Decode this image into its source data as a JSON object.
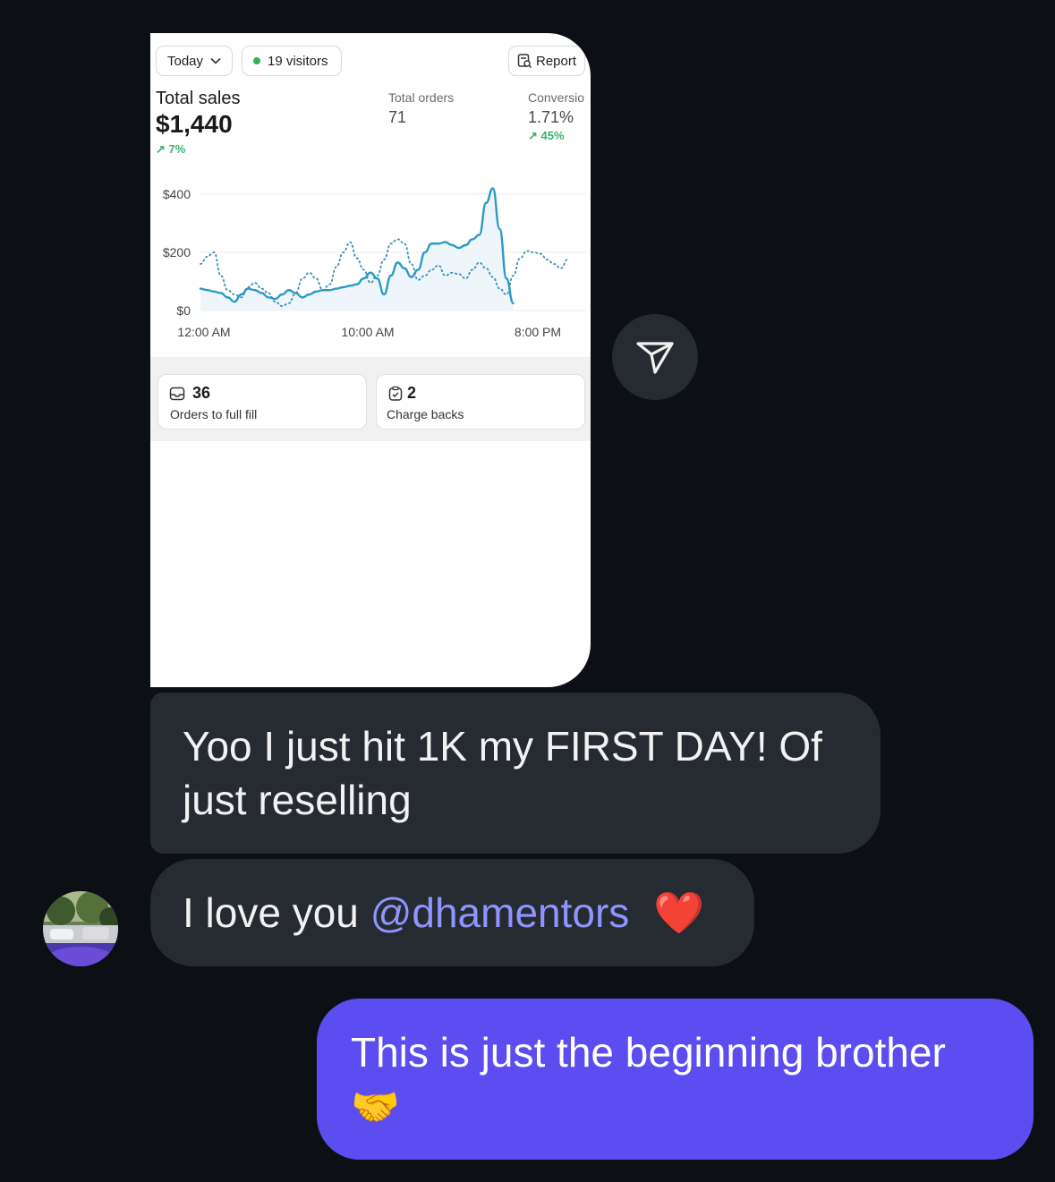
{
  "screenshot": {
    "period_label": "Today",
    "visitors_label": "19 visitors",
    "report_label": "Report",
    "total_sales": {
      "label": "Total sales",
      "value": "$1,440",
      "delta": "7%"
    },
    "total_orders": {
      "label": "Total orders",
      "value": "71"
    },
    "conversion": {
      "label": "Conversio",
      "value": "1.71%",
      "delta": "45%"
    },
    "stats": [
      {
        "value": "36",
        "label": "Orders to full fill",
        "icon": "inbox-icon"
      },
      {
        "value": "2",
        "label": "Charge backs",
        "icon": "clipboard-check-icon"
      }
    ]
  },
  "chart_data": {
    "type": "line",
    "ylim": [
      0,
      400
    ],
    "yticks": [
      "$400",
      "$200",
      "$0"
    ],
    "xticks": [
      "12:00 AM",
      "10:00 AM",
      "8:00 PM"
    ],
    "x": [
      0,
      1,
      2,
      3,
      4,
      5,
      6,
      7,
      8,
      9,
      10,
      11,
      12,
      13,
      14,
      15,
      16,
      17,
      18,
      19,
      20,
      21,
      22,
      23,
      24,
      25,
      26,
      27,
      28,
      29,
      30,
      31,
      32,
      33,
      34,
      35,
      36,
      37,
      38,
      39,
      40,
      41,
      42,
      43,
      44,
      45,
      46,
      47,
      48,
      49,
      50,
      51,
      52,
      53
    ],
    "series": [
      {
        "style": "solid",
        "values": [
          75,
          70,
          65,
          60,
          45,
          30,
          55,
          75,
          70,
          60,
          45,
          40,
          55,
          70,
          60,
          45,
          55,
          65,
          70,
          70,
          75,
          80,
          85,
          90,
          110,
          130,
          110,
          55,
          120,
          165,
          145,
          115,
          140,
          200,
          230,
          230,
          235,
          225,
          215,
          225,
          245,
          260,
          370,
          420,
          280,
          110,
          25
        ]
      },
      {
        "style": "dotted",
        "values": [
          160,
          185,
          200,
          120,
          70,
          55,
          45,
          80,
          95,
          75,
          60,
          30,
          15,
          25,
          60,
          110,
          130,
          110,
          70,
          90,
          150,
          200,
          235,
          180,
          140,
          95,
          120,
          175,
          230,
          245,
          230,
          160,
          105,
          120,
          140,
          155,
          120,
          130,
          125,
          110,
          140,
          165,
          145,
          115,
          75,
          55,
          120,
          180,
          205,
          200,
          195,
          175,
          160,
          145,
          175
        ]
      }
    ],
    "colors": {
      "solid": "#2b9bc6",
      "dotted": "#3a8fb5"
    },
    "grid": true
  },
  "share_button": {
    "icon": "send-icon"
  },
  "messages": [
    {
      "text": "Yoo I just hit 1K my FIRST DAY! Of just reselling"
    },
    {
      "text_before": "I love you ",
      "mention": "@dhamentors",
      "emoji": "❤️"
    },
    {
      "text": "This is just the beginning brother",
      "emoji": "🤝"
    }
  ],
  "colors": {
    "background": "#0c0f14",
    "incoming_bubble": "#262a31",
    "outgoing_bubble": "#5c4df0",
    "mention": "#8e95ff"
  }
}
